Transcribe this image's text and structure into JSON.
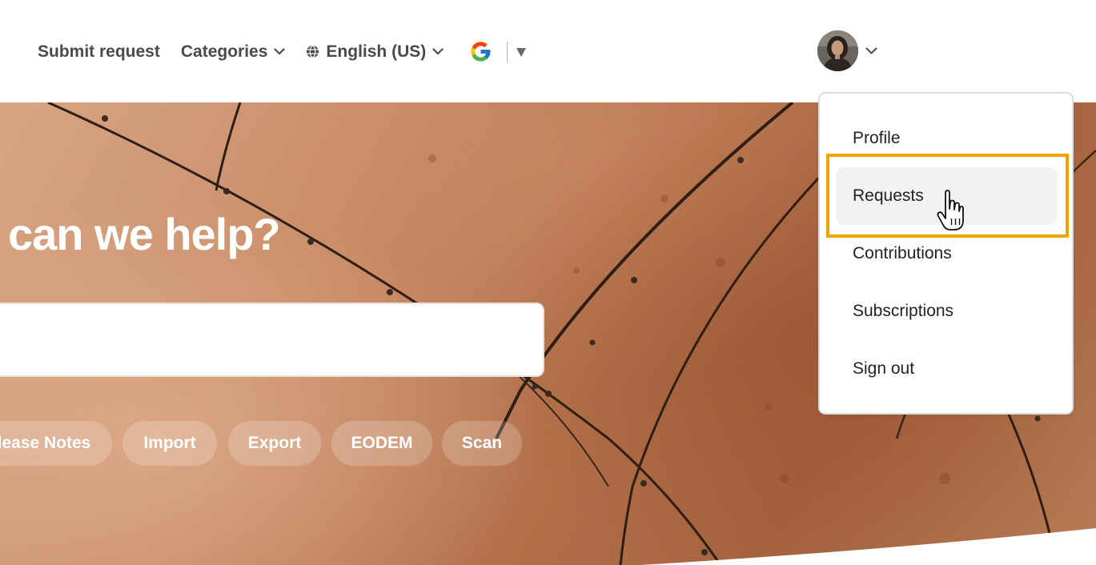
{
  "header": {
    "nav": [
      {
        "label": "Submit request",
        "dropdown": false
      },
      {
        "label": "Categories",
        "dropdown": true
      },
      {
        "label": "English (US)",
        "dropdown": true,
        "icon": "globe-icon"
      }
    ],
    "translate_widget": {
      "icon": "google-icon",
      "caret": "triangle-down-icon"
    },
    "user_menu": {
      "avatar": "user-avatar",
      "caret": "chevron-down-icon"
    }
  },
  "hero": {
    "headline": "can we help?",
    "search": {
      "placeholder": "",
      "value": ""
    },
    "chips": [
      "lease Notes",
      "Import",
      "Export",
      "EODEM",
      "Scan"
    ]
  },
  "dropdown": {
    "items": [
      "Profile",
      "Requests",
      "Contributions",
      "Subscriptions",
      "Sign out"
    ],
    "hovered": "Requests"
  },
  "colors": {
    "highlight": "#f5a100",
    "nav_text": "#4a4a4a",
    "menu_hover": "#f2f2f2",
    "hero_copper": "#b3714a"
  }
}
